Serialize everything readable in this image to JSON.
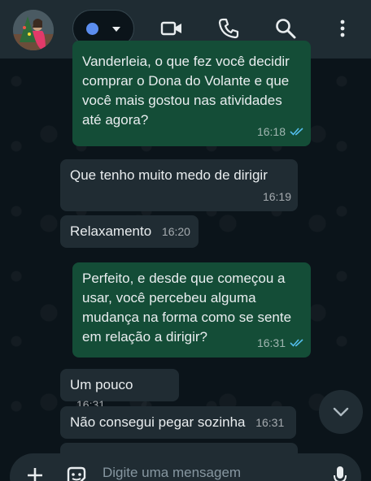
{
  "header": {
    "avatar_icon": "christmas-tree-avatar",
    "status_color": "#5b8def",
    "icons": [
      "video-call-icon",
      "voice-call-icon",
      "search-icon",
      "more-options-icon"
    ]
  },
  "messages": [
    {
      "direction": "out",
      "text": "Vanderleia, o que fez você decidir comprar o Dona do Volante e que você mais gostou nas atividades até agora?",
      "time": "16:18",
      "read": true
    },
    {
      "direction": "in",
      "text": "Que tenho muito medo de dirigir",
      "time": "16:19"
    },
    {
      "direction": "in",
      "text": "Relaxamento",
      "time": "16:20"
    },
    {
      "direction": "out",
      "text": "Perfeito, e desde que começou a usar, você percebeu alguma mudança na forma como se sente em relação a dirigir?",
      "time": "16:31",
      "read": true
    },
    {
      "direction": "in",
      "text": "Um pouco",
      "time": "16:31"
    },
    {
      "direction": "in",
      "text": "Não consegui pegar sozinha",
      "time": "16:31"
    }
  ],
  "composer": {
    "placeholder": "Digite uma mensagem",
    "icons": [
      "plus-icon",
      "sticker-icon",
      "microphone-icon"
    ]
  },
  "colors": {
    "outgoing_bubble": "#144d37",
    "incoming_bubble": "#202c33",
    "read_ticks": "#53bdeb"
  }
}
